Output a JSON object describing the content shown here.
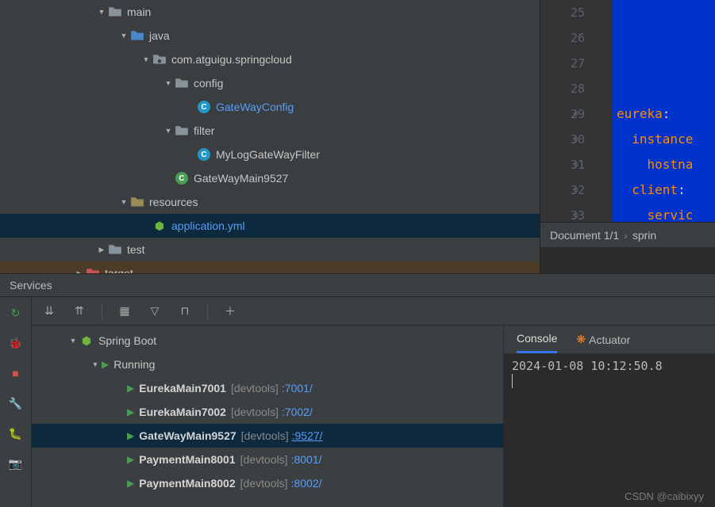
{
  "tree": {
    "main": "main",
    "java": "java",
    "pkg": "com.atguigu.springcloud",
    "config": "config",
    "gatewayConfig": "GateWayConfig",
    "filter": "filter",
    "myLogFilter": "MyLogGateWayFilter",
    "gatewayMain": "GateWayMain9527",
    "resources": "resources",
    "appYml": "application.yml",
    "test": "test",
    "target": "target"
  },
  "editor": {
    "lines": [
      "25",
      "26",
      "27",
      "28",
      "29",
      "30",
      "31",
      "32",
      "33"
    ],
    "l29a": "eureka",
    "l30a": "instance",
    "l31a": "hostna",
    "l32a": "client",
    "l33a": "servic",
    "colon": ":",
    "status_doc": "Document 1/1",
    "status_path": "sprin"
  },
  "services_header": "Services",
  "services_tree": {
    "root": "Spring Boot",
    "group": "Running",
    "items": [
      {
        "name": "EurekaMain7001",
        "tag": "[devtools]",
        "port": ":7001/"
      },
      {
        "name": "EurekaMain7002",
        "tag": "[devtools]",
        "port": ":7002/"
      },
      {
        "name": "GateWayMain9527",
        "tag": "[devtools]",
        "port": ":9527/"
      },
      {
        "name": "PaymentMain8001",
        "tag": "[devtools]",
        "port": ":8001/"
      },
      {
        "name": "PaymentMain8002",
        "tag": "[devtools]",
        "port": ":8002/"
      }
    ]
  },
  "console": {
    "tab_console": "Console",
    "tab_actuator": "Actuator",
    "line1": "2024-01-08 10:12:50.8"
  },
  "watermark": "CSDN @caibixyy"
}
